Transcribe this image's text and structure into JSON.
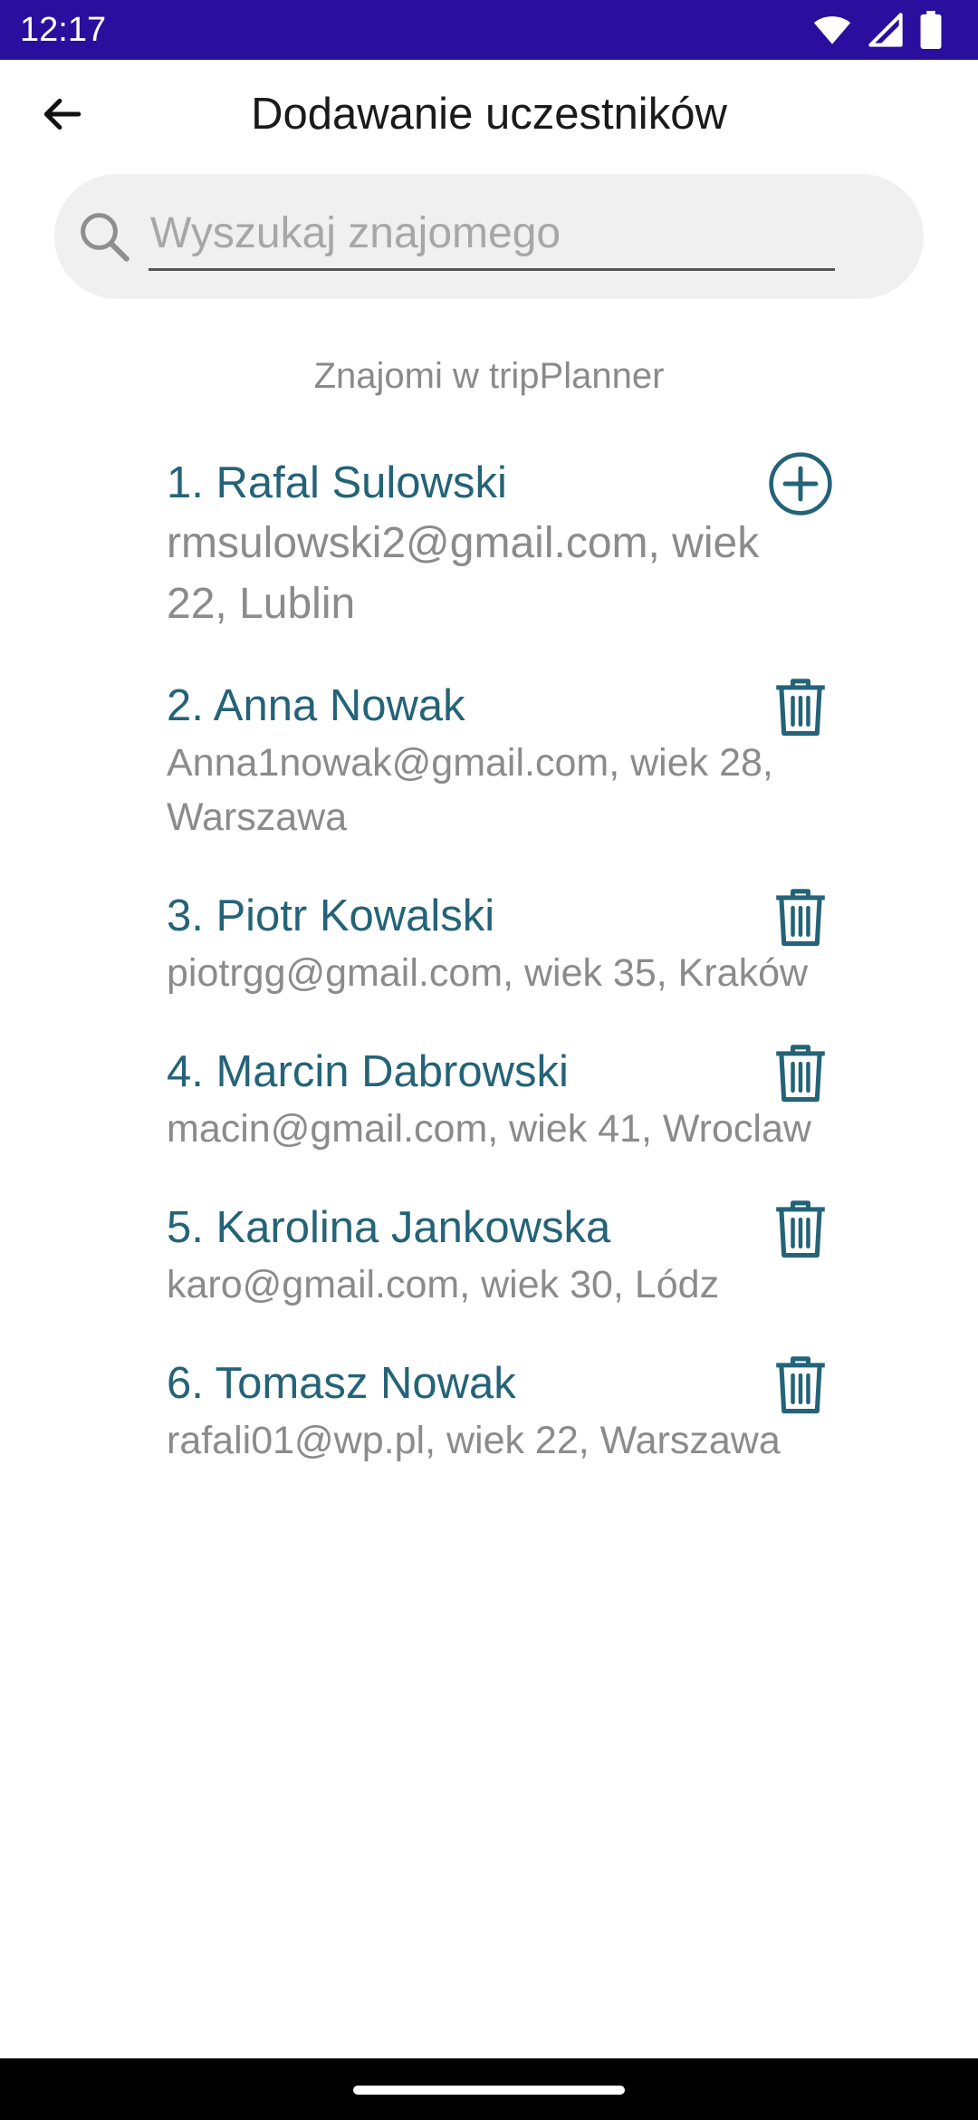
{
  "status_bar": {
    "time": "12:17",
    "icons": [
      "wifi-icon",
      "signal-icon",
      "battery-icon"
    ]
  },
  "app_bar": {
    "title": "Dodawanie uczestników",
    "back_icon": "arrow-left-icon"
  },
  "search": {
    "placeholder": "Wyszukaj znajomego",
    "value": ""
  },
  "section_label": "Znajomi w tripPlanner",
  "colors": {
    "accent": "#246378",
    "status_bar": "#2a0f9e",
    "secondary_text": "#8b8b8b",
    "search_bg": "#f0f0f0"
  },
  "friends": [
    {
      "name": "1. Rafal Sulowski",
      "details": "rmsulowski2@gmail.com, wiek 22, Lublin",
      "action": "add-circle-icon"
    },
    {
      "name": "2. Anna Nowak",
      "details": "Anna1nowak@gmail.com, wiek 28, Warszawa",
      "action": "trash-icon"
    },
    {
      "name": "3. Piotr Kowalski",
      "details": "piotrgg@gmail.com, wiek 35, Kraków",
      "action": "trash-icon"
    },
    {
      "name": "4. Marcin Dabrowski",
      "details": "macin@gmail.com, wiek 41, Wroclaw",
      "action": "trash-icon"
    },
    {
      "name": "5. Karolina Jankowska",
      "details": "karo@gmail.com, wiek 30, Lódz",
      "action": "trash-icon"
    },
    {
      "name": "6. Tomasz Nowak",
      "details": "rafali01@wp.pl, wiek 22, Warszawa",
      "action": "trash-icon"
    }
  ]
}
